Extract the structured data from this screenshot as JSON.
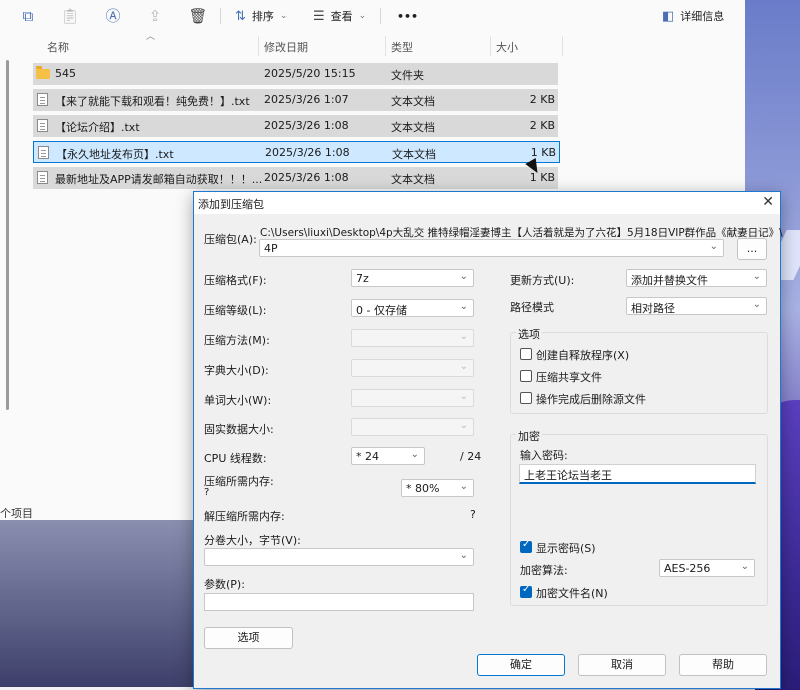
{
  "toolbar": {
    "sort_label": "排序",
    "view_label": "查看",
    "more_label": "•••",
    "details_label": "详细信息"
  },
  "columns": {
    "name": "名称",
    "date": "修改日期",
    "type": "类型",
    "size": "大小"
  },
  "files": [
    {
      "name": "545",
      "date": "2025/5/20 15:15",
      "type": "文件夹",
      "size": "",
      "icon": "folder-icon"
    },
    {
      "name": "【来了就能下载和观看！纯免费！】.txt",
      "date": "2025/3/26 1:07",
      "type": "文本文档",
      "size": "2 KB",
      "icon": "text-file-icon"
    },
    {
      "name": "【论坛介绍】.txt",
      "date": "2025/3/26 1:08",
      "type": "文本文档",
      "size": "2 KB",
      "icon": "text-file-icon"
    },
    {
      "name": "【永久地址发布页】.txt",
      "date": "2025/3/26 1:08",
      "type": "文本文档",
      "size": "1 KB",
      "icon": "text-file-icon"
    },
    {
      "name": "最新地址及APP请发邮箱自动获取！！！...",
      "date": "2025/3/26 1:08",
      "type": "文本文档",
      "size": "1 KB",
      "icon": "text-file-icon"
    }
  ],
  "status": "个项目",
  "dialog": {
    "title": "添加到压缩包",
    "close": "✕",
    "archive_label": "压缩包(A):",
    "archive_path": "C:\\Users\\liuxi\\Desktop\\4p大乱交 推特绿帽淫妻博主【人活着就是为了六花】5月18日VIP群作品《献妻日记》\\",
    "archive_name": "4P",
    "browse_label": "...",
    "format_label": "压缩格式(F):",
    "format_value": "7z",
    "level_label": "压缩等级(L):",
    "level_value": "0 - 仅存储",
    "method_label": "压缩方法(M):",
    "dict_label": "字典大小(D):",
    "word_label": "单词大小(W):",
    "solid_label": "固实数据大小:",
    "cpu_label": "CPU 线程数:",
    "cpu_value": "* 24",
    "cpu_total": "/ 24",
    "mem_comp_label": "压缩所需内存:",
    "mem_comp_q": "?",
    "mem_value": "* 80%",
    "mem_decomp_label": "解压缩所需内存:",
    "mem_decomp_q": "?",
    "volume_label": "分卷大小，字节(V):",
    "params_label": "参数(P):",
    "options_btn": "选项",
    "update_label": "更新方式(U):",
    "update_value": "添加并替换文件",
    "path_label": "路径模式",
    "path_value": "相对路径",
    "options_group": "选项",
    "opt_sfx": "创建自释放程序(X)",
    "opt_shared": "压缩共享文件",
    "opt_delete": "操作完成后删除源文件",
    "encrypt_group": "加密",
    "pwd_label": "输入密码:",
    "pwd_value": "上老王论坛当老王",
    "show_pwd": "显示密码(S)",
    "enc_method_label": "加密算法:",
    "enc_method_value": "AES-256",
    "enc_names": "加密文件名(N)",
    "ok": "确定",
    "cancel": "取消",
    "help": "帮助"
  }
}
